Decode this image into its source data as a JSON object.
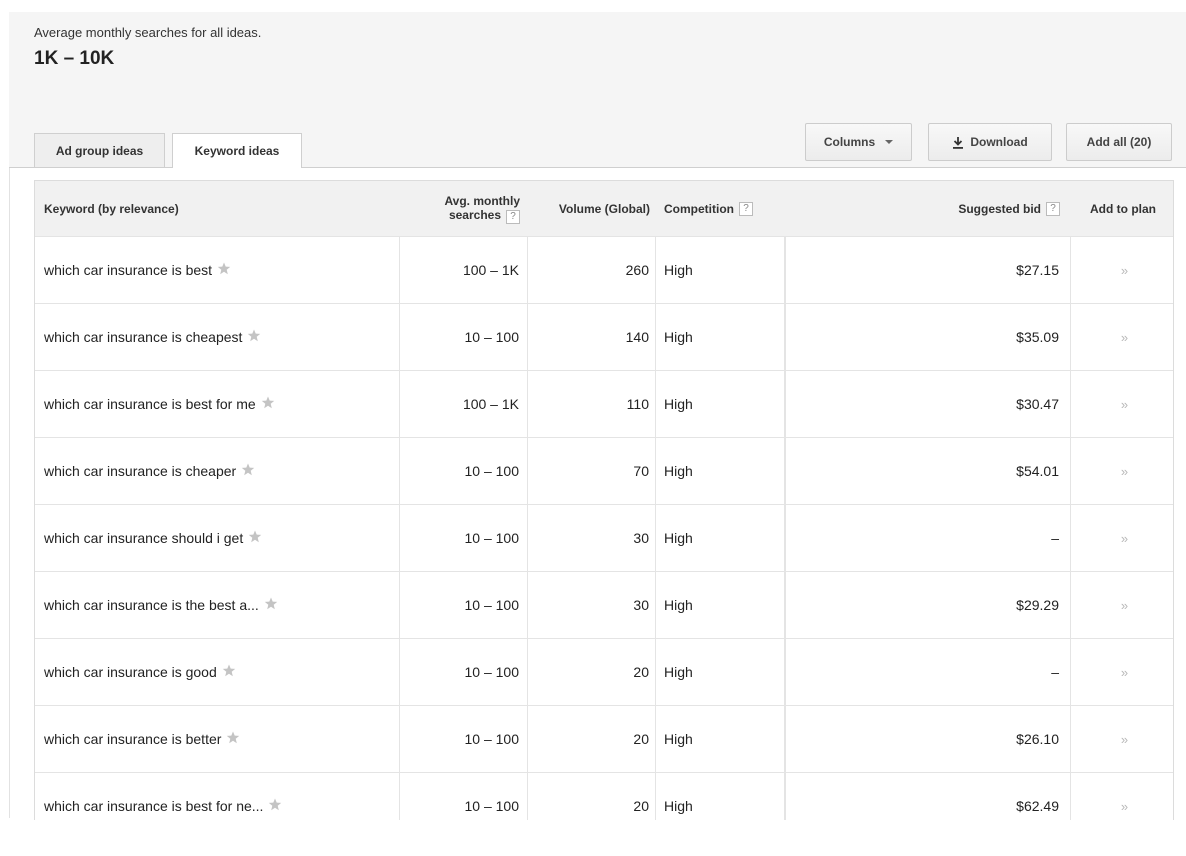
{
  "summary": {
    "label": "Average monthly searches for all ideas.",
    "value": "1K – 10K"
  },
  "tabs": [
    {
      "label": "Ad group ideas"
    },
    {
      "label": "Keyword ideas"
    }
  ],
  "toolbar": {
    "columns_label": "Columns",
    "download_label": "Download",
    "addall_label": "Add all (20)"
  },
  "table": {
    "headers": {
      "keyword": "Keyword (by relevance)",
      "avg_line1": "Avg. monthly",
      "avg_line2": "searches",
      "volume": "Volume (Global)",
      "competition": "Competition",
      "bid": "Suggested bid",
      "add": "Add to plan",
      "help": "?"
    },
    "add_glyph": "»",
    "rows": [
      {
        "keyword": "which car insurance is best",
        "avg": "100 – 1K",
        "volume": "260",
        "competition": "High",
        "bid": "$27.15"
      },
      {
        "keyword": "which car insurance is cheapest",
        "avg": "10 – 100",
        "volume": "140",
        "competition": "High",
        "bid": "$35.09"
      },
      {
        "keyword": "which car insurance is best for me",
        "avg": "100 – 1K",
        "volume": "110",
        "competition": "High",
        "bid": "$30.47"
      },
      {
        "keyword": "which car insurance is cheaper",
        "avg": "10 – 100",
        "volume": "70",
        "competition": "High",
        "bid": "$54.01"
      },
      {
        "keyword": "which car insurance should i get",
        "avg": "10 – 100",
        "volume": "30",
        "competition": "High",
        "bid": "–"
      },
      {
        "keyword": "which car insurance is the best a...",
        "avg": "10 – 100",
        "volume": "30",
        "competition": "High",
        "bid": "$29.29"
      },
      {
        "keyword": "which car insurance is good",
        "avg": "10 – 100",
        "volume": "20",
        "competition": "High",
        "bid": "–"
      },
      {
        "keyword": "which car insurance is better",
        "avg": "10 – 100",
        "volume": "20",
        "competition": "High",
        "bid": "$26.10"
      },
      {
        "keyword": "which car insurance is best for ne...",
        "avg": "10 – 100",
        "volume": "20",
        "competition": "High",
        "bid": "$62.49"
      }
    ]
  },
  "icons": {
    "star": "star-icon",
    "download": "download-icon",
    "caret": "caret-down-icon",
    "add": "add-to-plan-icon"
  }
}
